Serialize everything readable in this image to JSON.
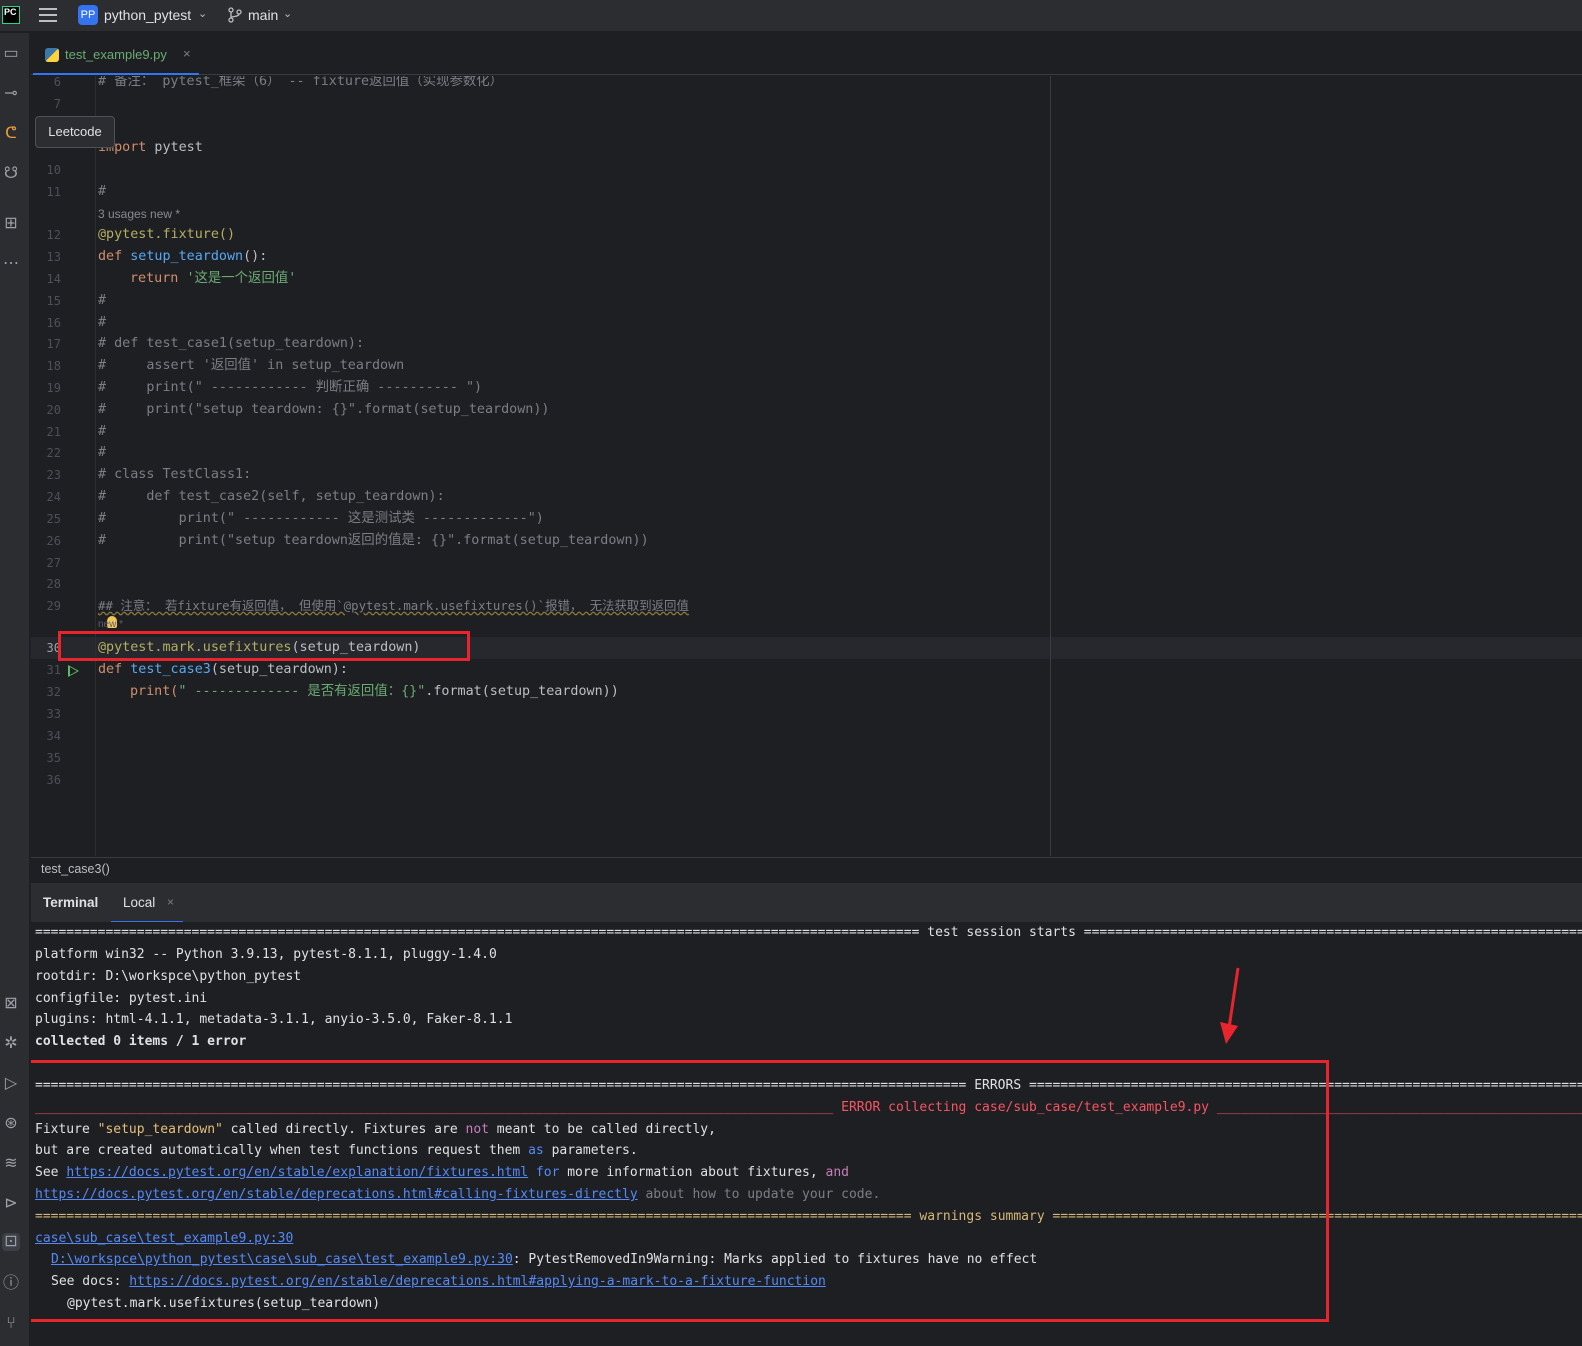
{
  "titlebar": {
    "app_logo": "PC",
    "project_badge": "PP",
    "project_name": "python_pytest",
    "branch": "main"
  },
  "tooltip": "Leetcode",
  "tab": {
    "file": "test_example9.py"
  },
  "editor": {
    "line6": "# 备注： pytest_框架（6） -- fixture返回值（实现参数化）",
    "line7": "7",
    "import_kw": "import",
    "import_mod": " pytest",
    "usages_hint": "3 usages   new *",
    "new_hint": "new *",
    "fixture_dec": "@pytest.fixture()",
    "def_kw": "def ",
    "setup_fn": "setup_teardown",
    "setup_sig": "():",
    "return_kw": "return ",
    "return_str": "'这是一个返回值'",
    "hash": "#",
    "c17": "# def test_case1(setup_teardown):",
    "c18": "#     assert '返回值' in setup_teardown",
    "c19": "#     print(\" ------------ 判断正确 ---------- \")",
    "c20": "#     print(\"setup teardown: {}\".format(setup_teardown))",
    "c23": "# class TestClass1:",
    "c24": "#     def test_case2(self, setup_teardown):",
    "c25": "#         print(\" ------------ 这是测试类 -------------\")",
    "c26": "#         print(\"setup teardown返回的值是: {}\".format(setup_teardown))",
    "c29": "## 注意： 若fixture有返回值， 但使用`@pytest.mark.usefixtures()`报错， 无法获取到返回值",
    "usefix_dec": "@pytest.mark.usefixtures",
    "usefix_arg": "(setup_teardown)",
    "case3_fn": "test_case3",
    "case3_sig": "(setup_teardown):",
    "print_kw": "print(",
    "print_str": "\" ------------- 是否有返回值：{}\"",
    "print_rest": ".format(setup_teardown))",
    "line_numbers": [
      "6",
      "7",
      "10",
      "11",
      "12",
      "13",
      "14",
      "15",
      "16",
      "17",
      "18",
      "19",
      "20",
      "21",
      "22",
      "23",
      "24",
      "25",
      "26",
      "27",
      "28",
      "29",
      "30",
      "31",
      "32",
      "33",
      "34",
      "35",
      "36"
    ]
  },
  "breadcrumb": "test_case3()",
  "terminal": {
    "title": "Terminal",
    "tab": "Local",
    "session_line": "================================================================================================================= test session starts ==================================================================================",
    "platform": "platform win32 -- Python 3.9.13, pytest-8.1.1, pluggy-1.4.0",
    "rootdir": "rootdir: D:\\workspce\\python_pytest",
    "configfile": "configfile: pytest.ini",
    "plugins": "plugins: html-4.1.1, metadata-3.1.1, anyio-3.5.0, Faker-8.1.1",
    "collected": "collected 0 items / 1 error",
    "errors_line": "======================================================================================================================= ERRORS =========================================================================================",
    "err_collect_left": "______________________________________________________________________________________________________ ",
    "err_collect_mid": "ERROR collecting case/sub_case/test_example9.py",
    "err_collect_right": " ________________________________________________________",
    "f1_a": "Fixture ",
    "f1_b": "\"setup_teardown\"",
    "f1_c": " called directly. Fixtures are ",
    "f1_d": "not",
    "f1_e": " meant to be called directly,",
    "f2_a": "but are created automatically when test functions request them ",
    "f2_b": "as",
    "f2_c": " parameters.",
    "f3_a": "See ",
    "f3_link": "https://docs.pytest.org/en/stable/explanation/fixtures.html",
    "f3_b": " for",
    "f3_c": " more information about fixtures, ",
    "f3_d": "and",
    "f4_link": "https://docs.pytest.org/en/stable/deprecations.html#calling-fixtures-directly",
    "f4_rest": " about how to update your code.",
    "warn_left": "================================================================================================================ ",
    "warn_mid": "warnings summary",
    "warn_right": " ===========================================================================================",
    "w1": "case\\sub_case\\test_example9.py:30",
    "w2_link": "D:\\workspce\\python_pytest\\case\\sub_case\\test_example9.py:30",
    "w2_rest": ": PytestRemovedIn9Warning: Marks applied to fixtures have no effect",
    "w3_a": "See docs: ",
    "w3_link": "https://docs.pytest.org/en/stable/deprecations.html#applying-a-mark-to-a-fixture-function",
    "w4": "@pytest.mark.usefixtures(setup_teardown)"
  }
}
